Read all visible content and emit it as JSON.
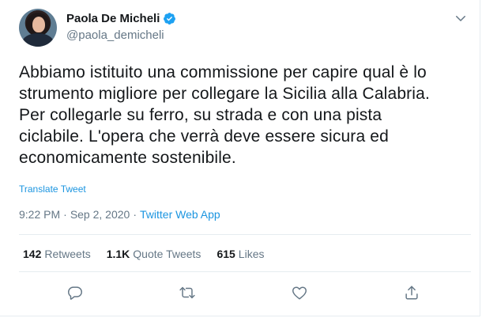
{
  "author": {
    "display_name": "Paola De Micheli",
    "handle": "@paola_demicheli",
    "verified": true
  },
  "tweet": {
    "text_lines": [
      "Abbiamo istituito una commissione per capire qual è lo",
      "strumento migliore per collegare la Sicilia alla Calabria.",
      "Per collegarle su ferro, su strada e con una pista",
      "ciclabile. L'opera che verrà deve essere sicura ed",
      "economicamente sostenibile."
    ],
    "translate_label": "Translate Tweet",
    "time": "9:22 PM",
    "date": "Sep 2, 2020",
    "separator": "·",
    "source": "Twitter Web App"
  },
  "stats": {
    "retweets_count": "142",
    "retweets_label": "Retweets",
    "quotes_count": "1.1K",
    "quotes_label": "Quote Tweets",
    "likes_count": "615",
    "likes_label": "Likes"
  },
  "actions": {
    "reply_icon": "reply-icon",
    "retweet_icon": "retweet-icon",
    "like_icon": "heart-icon",
    "share_icon": "share-icon"
  },
  "colors": {
    "link": "#1b95e0",
    "secondary_text": "#657786",
    "verified": "#1da1f2"
  }
}
